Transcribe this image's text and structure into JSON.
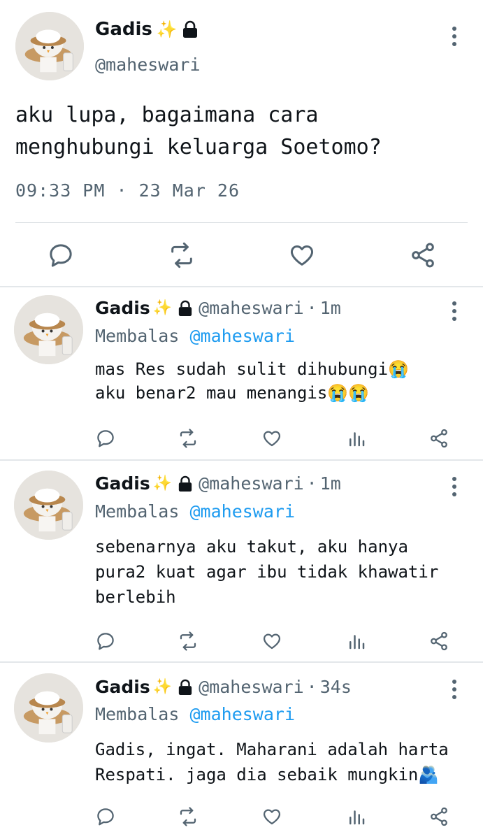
{
  "main_tweet": {
    "display_name": "Gadis",
    "name_emoji": "✨",
    "lock_icon": "lock-icon",
    "handle": "@maheswari",
    "text": "aku lupa, bagaimana cara\nmenghubungi keluarga Soetomo?",
    "timestamp": "09:33 PM · 23 Mar 26",
    "actions": [
      "reply-icon",
      "retweet-icon",
      "like-icon",
      "share-icon"
    ]
  },
  "replies": [
    {
      "display_name": "Gadis",
      "name_emoji": "✨",
      "handle": "@maheswari",
      "separator": "·",
      "time": "1m",
      "replying_label": "Membalas",
      "replying_to": "@maheswari",
      "text": "mas Res sudah sulit dihubungi😭\naku benar2 mau menangis😭😭"
    },
    {
      "display_name": "Gadis",
      "name_emoji": "✨",
      "handle": "@maheswari",
      "separator": "·",
      "time": "1m",
      "replying_label": "Membalas",
      "replying_to": "@maheswari",
      "text": "sebenarnya aku takut, aku hanya\npura2 kuat agar ibu tidak khawatir\nberlebih"
    },
    {
      "display_name": "Gadis",
      "name_emoji": "✨",
      "handle": "@maheswari",
      "separator": "·",
      "time": "34s",
      "replying_label": "Membalas",
      "replying_to": "@maheswari",
      "text": "Gadis, ingat. Maharani adalah harta\nRespati. jaga dia sebaik mungkin🫂"
    }
  ],
  "reply_actions": [
    "reply-icon",
    "retweet-icon",
    "like-icon",
    "views-icon",
    "share-icon"
  ],
  "colors": {
    "text": "#0f1419",
    "secondary": "#536471",
    "link": "#1d9bf0",
    "divider": "#e3e7ea"
  }
}
